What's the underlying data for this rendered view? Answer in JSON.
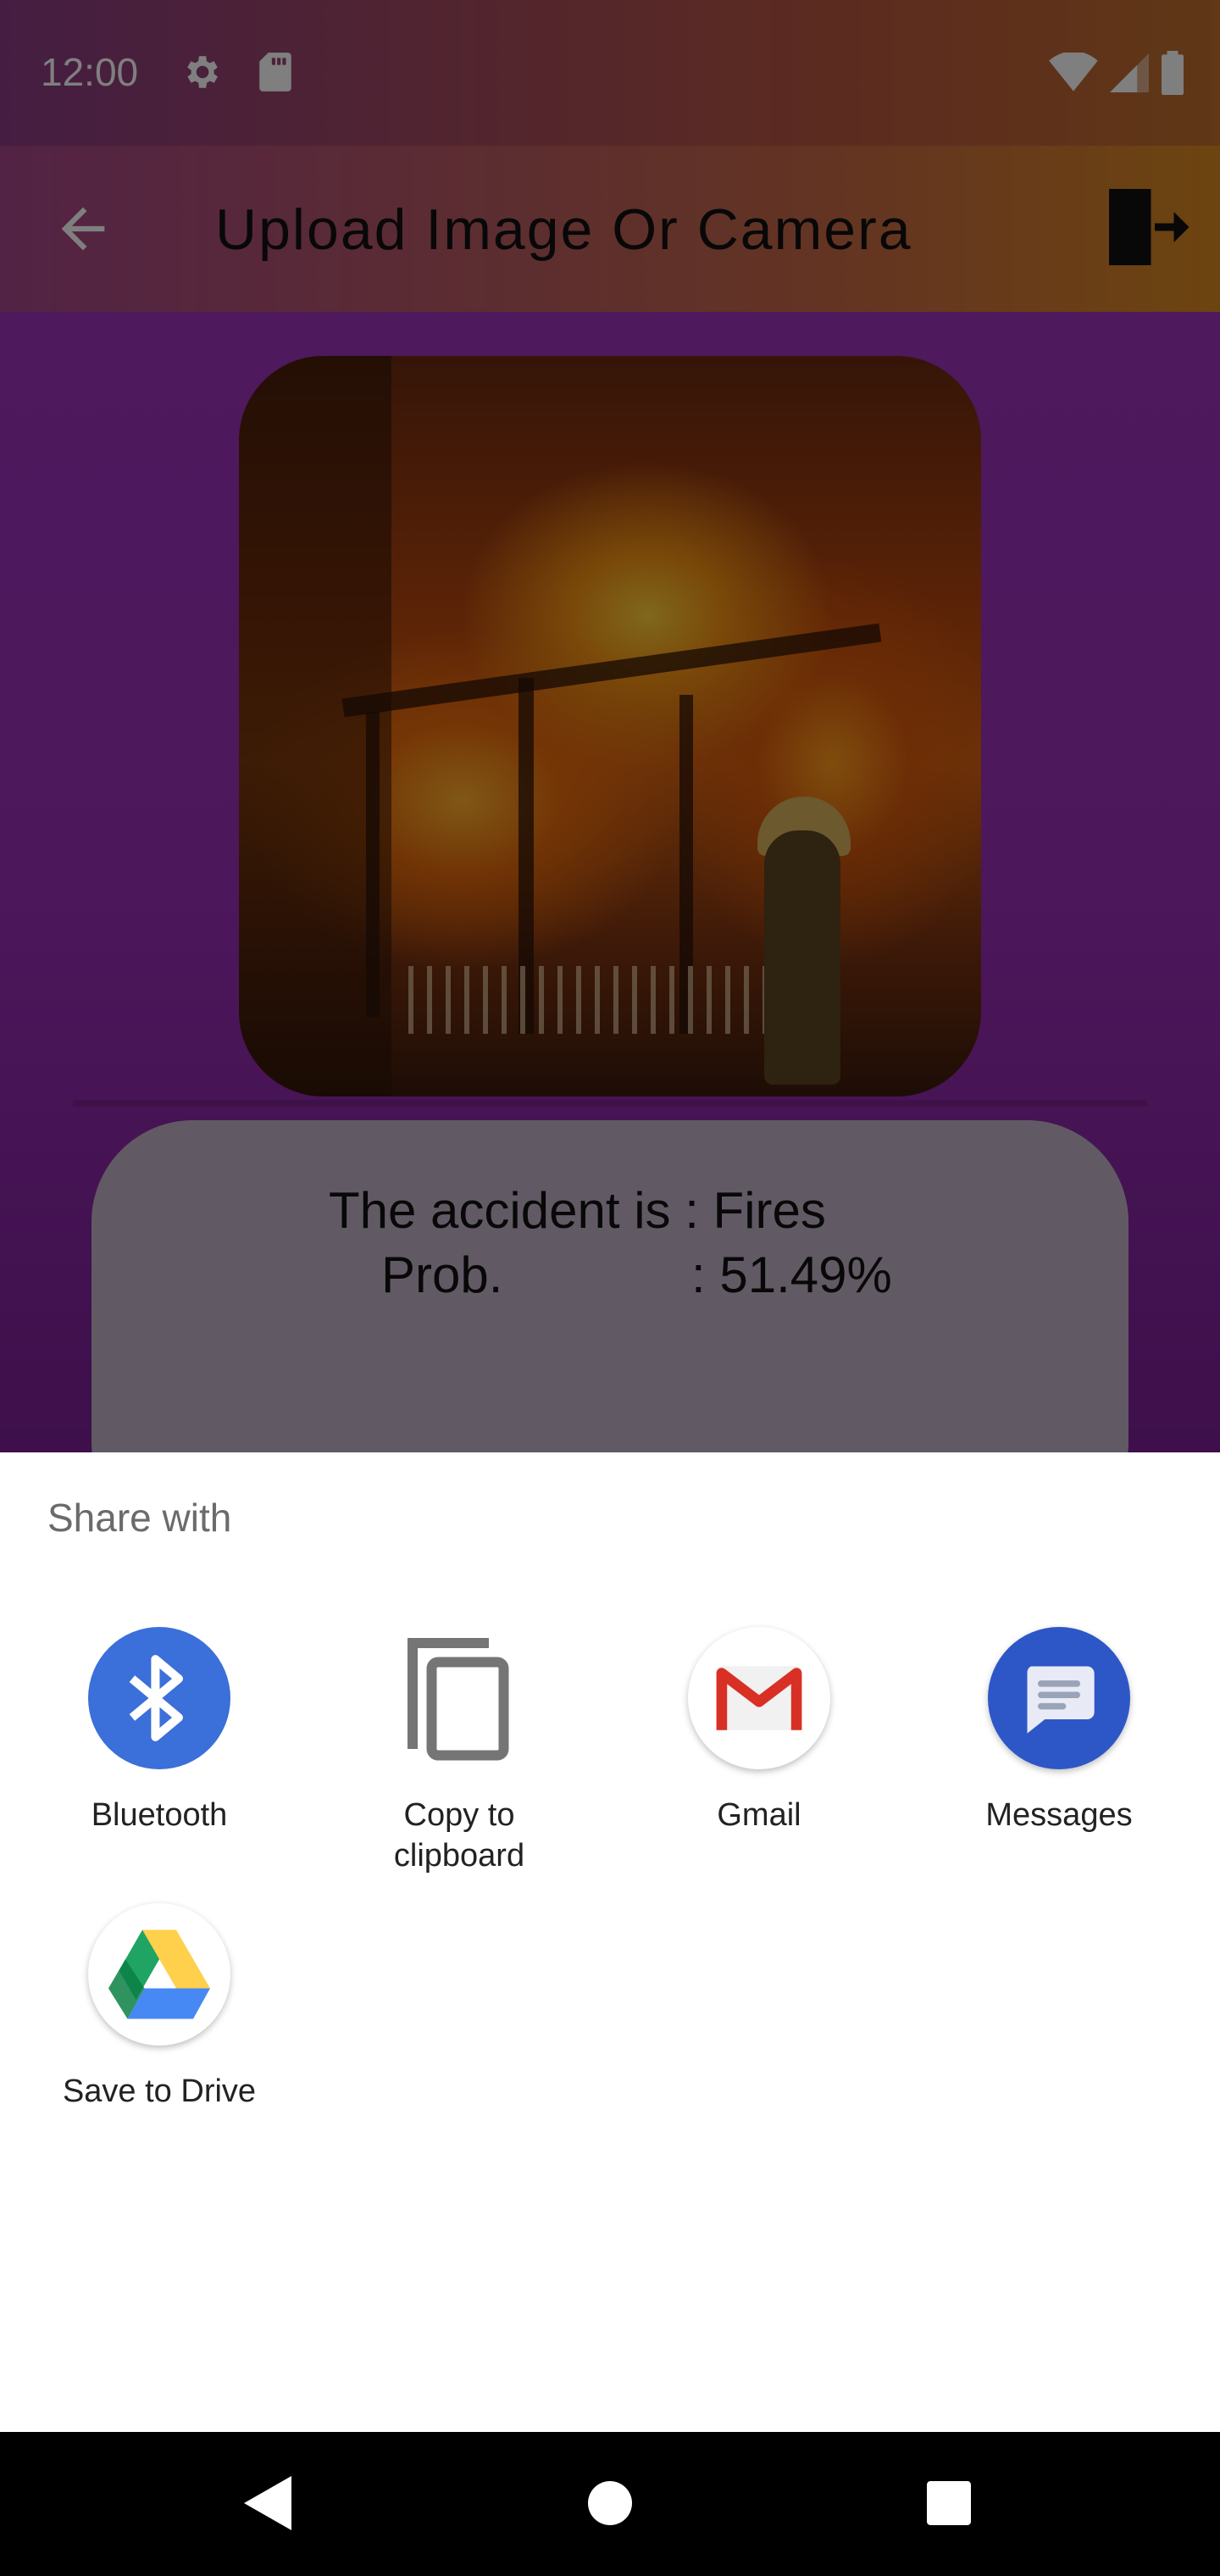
{
  "status_bar": {
    "time": "12:00",
    "left_icons": [
      "settings-gear-icon",
      "sd-card-icon"
    ],
    "right_icons": [
      "wifi-icon",
      "cell-signal-icon",
      "battery-icon"
    ]
  },
  "app_bar": {
    "title": "Upload Image Or Camera",
    "back_icon": "arrow-back-icon",
    "exit_icon": "exit-door-icon"
  },
  "result": {
    "line1": "The accident is : Fires",
    "line2_label": "Prob.",
    "line2_value": ": 51.49%"
  },
  "share_sheet": {
    "title": "Share with",
    "targets": [
      {
        "label": "Bluetooth",
        "icon": "bluetooth-icon",
        "color": "#3b6fd9"
      },
      {
        "label": "Copy to clipboard",
        "icon": "copy-icon",
        "color": "#757575"
      },
      {
        "label": "Gmail",
        "icon": "gmail-icon",
        "color": "#d93025"
      },
      {
        "label": "Messages",
        "icon": "messages-icon",
        "color": "#2d57c7"
      },
      {
        "label": "Save to Drive",
        "icon": "google-drive-icon",
        "color": "#1fa463"
      }
    ]
  },
  "nav_bar": {
    "buttons": [
      "back-triangle-icon",
      "home-circle-icon",
      "recents-square-icon"
    ]
  }
}
